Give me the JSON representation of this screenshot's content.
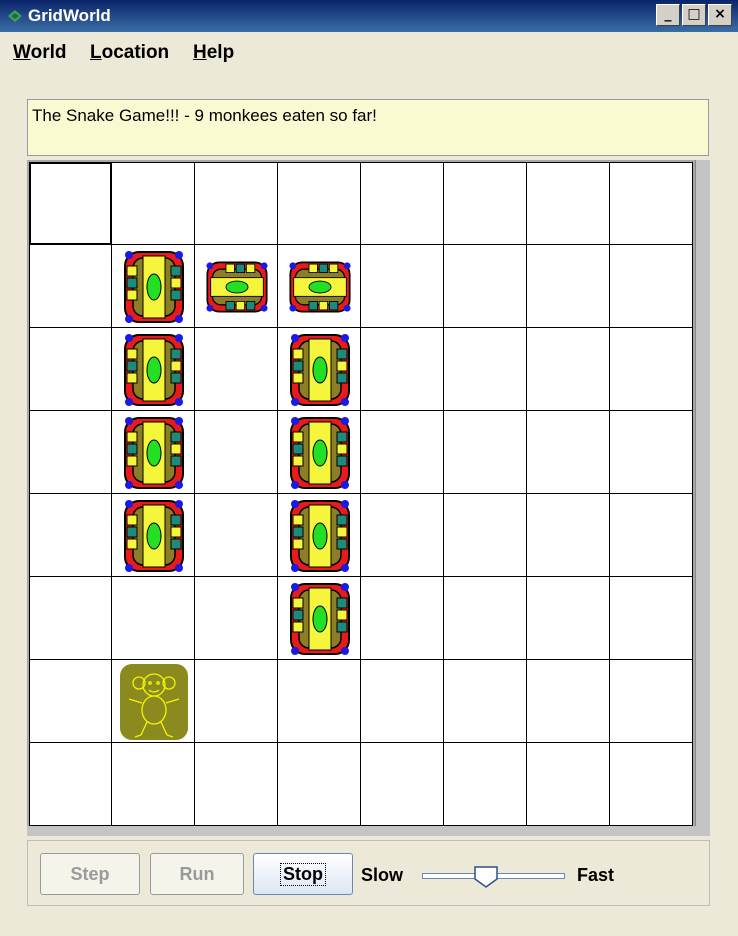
{
  "window": {
    "title": "GridWorld",
    "minimize_icon": "minimize-icon",
    "maximize_icon": "maximize-icon",
    "close_icon": "close-icon",
    "title_bar_color": "#0A246A"
  },
  "menu": {
    "items": [
      {
        "label": "World",
        "mnemonic": "W",
        "rest": "orld"
      },
      {
        "label": "Location",
        "mnemonic": "L",
        "rest": "ocation"
      },
      {
        "label": "Help",
        "mnemonic": "H",
        "rest": "elp"
      }
    ]
  },
  "message": "The Snake Game!!! - 9 monkees eaten so far!",
  "grid": {
    "rows": 8,
    "cols": 8,
    "selected": [
      0,
      0
    ],
    "occupants": [
      {
        "type": "snake",
        "row": 1,
        "col": 1,
        "facing": "vertical"
      },
      {
        "type": "snake",
        "row": 1,
        "col": 2,
        "facing": "horizontal"
      },
      {
        "type": "snake",
        "row": 1,
        "col": 3,
        "facing": "horizontal"
      },
      {
        "type": "snake",
        "row": 2,
        "col": 1,
        "facing": "vertical"
      },
      {
        "type": "snake",
        "row": 3,
        "col": 1,
        "facing": "vertical"
      },
      {
        "type": "snake",
        "row": 4,
        "col": 1,
        "facing": "vertical"
      },
      {
        "type": "snake",
        "row": 2,
        "col": 3,
        "facing": "vertical"
      },
      {
        "type": "snake",
        "row": 3,
        "col": 3,
        "facing": "vertical"
      },
      {
        "type": "snake",
        "row": 4,
        "col": 3,
        "facing": "vertical"
      },
      {
        "type": "snake",
        "row": 5,
        "col": 3,
        "facing": "vertical"
      },
      {
        "type": "monkey",
        "row": 6,
        "col": 1
      }
    ]
  },
  "controls": {
    "step_label": "Step",
    "run_label": "Run",
    "stop_label": "Stop",
    "slow_label": "Slow",
    "fast_label": "Fast",
    "speed": 0.45
  },
  "colors": {
    "snake_red": "#E81A1A",
    "snake_olive": "#8B7E26",
    "snake_green": "#24E024",
    "snake_yellow": "#F5F53C",
    "snake_teal": "#1E8A7A",
    "snake_blue": "#1A1AE8",
    "monkey_bg": "#8B8A1E",
    "monkey_line": "#F5F500"
  }
}
